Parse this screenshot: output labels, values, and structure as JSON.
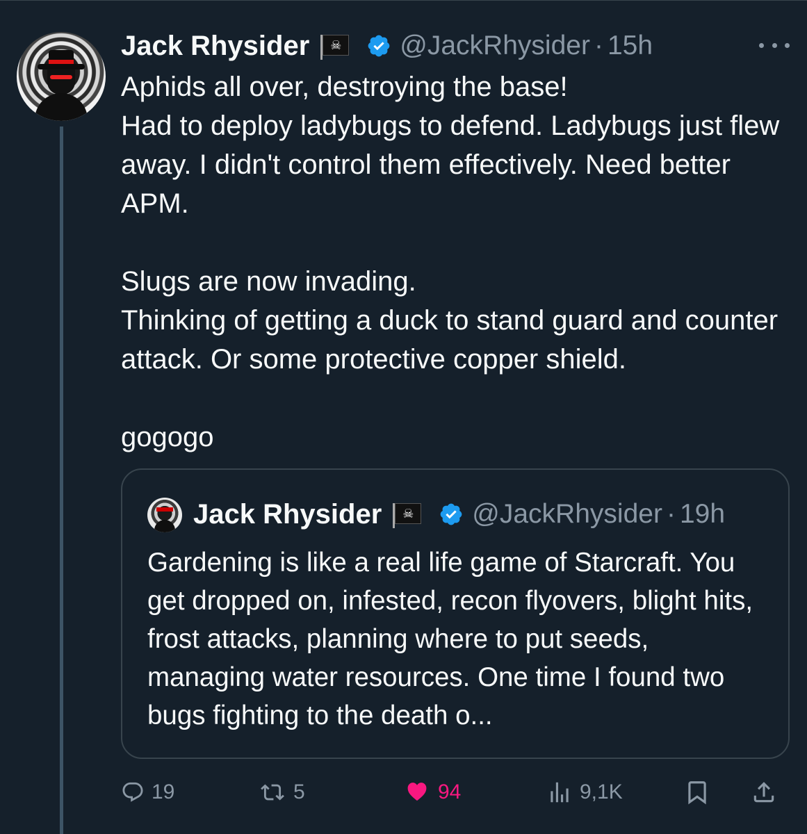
{
  "tweet": {
    "author_name": "Jack Rhysider",
    "flag_emoji": "🏴‍☠️",
    "handle": "@JackRhysider",
    "separator": "·",
    "time": "15h",
    "text": "Aphids all over, destroying the base!\nHad to deploy ladybugs to defend. Ladybugs just flew away. I didn't control them effectively. Need better APM.\n\nSlugs are now invading.\nThinking of getting a duck to stand guard and counter attack. Or some protective copper shield.\n\ngogogo"
  },
  "quoted_tweet": {
    "author_name": "Jack Rhysider",
    "handle": "@JackRhysider",
    "separator": "·",
    "time": "19h",
    "text": "Gardening is like a real life game of Starcraft. You get dropped on, infested, recon flyovers, blight hits, frost attacks, planning where to put seeds, managing water resources. One time I found two bugs fighting to the death o..."
  },
  "actions": {
    "replies": "19",
    "retweets": "5",
    "likes": "94",
    "views": "9,1K"
  },
  "colors": {
    "background": "#15202b",
    "text": "#f7f9f9",
    "muted": "#8b98a5",
    "verified": "#1d9bf0",
    "like": "#f91880",
    "border": "#38444d"
  },
  "icons": [
    "more-icon",
    "verified-badge-icon",
    "pirate-flag-icon",
    "reply-icon",
    "retweet-icon",
    "heart-icon",
    "views-icon",
    "bookmark-icon",
    "share-icon"
  ]
}
